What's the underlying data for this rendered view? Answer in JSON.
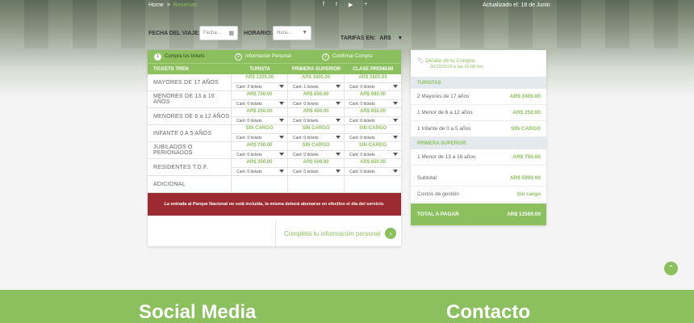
{
  "topbar": {
    "breadcrumb": {
      "home": "Home",
      "separator": ">",
      "current": "Reservas"
    },
    "social_icons": [
      "facebook-icon",
      "twitter-icon",
      "youtube-icon",
      "plus-icon"
    ],
    "updated": "Actualizado el: 18 de Junio"
  },
  "filters": {
    "date_label": "FECHA DEL VIAJE:",
    "date_placeholder": "Fecha...",
    "time_label": "HORARIO:",
    "time_placeholder": "Hora...",
    "currency_label": "TARIFAS EN:",
    "currency_value": "AR$"
  },
  "steps": [
    {
      "num": "1",
      "label": "Comprá tus tickets"
    },
    {
      "num": "2",
      "label": "Información Personal"
    },
    {
      "num": "3",
      "label": "Confirmar Compra"
    }
  ],
  "table": {
    "headers": [
      "TICKETS TREN",
      "TURISTA",
      "PRIMERA SUPERIOR",
      "CLASE PREMIUM"
    ],
    "rows": [
      {
        "label": "MAYORES DE 17 AÑOS",
        "cells": [
          {
            "price": "AR$ 1200.00",
            "qty": "Cant: 2 tickets"
          },
          {
            "price": "AR$ 1600.00",
            "qty": "Cant: 1 tickets"
          },
          {
            "price": "AR$ 2800.00",
            "qty": "Cant: 0 tickets"
          }
        ]
      },
      {
        "label": "MENORES DE 13 a 16 AÑOS",
        "cells": [
          {
            "price": "AR$ 750.00",
            "qty": "Cant: 0 tickets"
          },
          {
            "price": "AR$ 850.00",
            "qty": "Cant: 0 tickets"
          },
          {
            "price": "AR$ 980.00",
            "qty": "Cant: 0 tickets"
          }
        ]
      },
      {
        "label": "MENORES DE 6 a 12 AÑOS",
        "cells": [
          {
            "price": "AR$ 250.00",
            "qty": "Cant: 0 tickets"
          },
          {
            "price": "AR$ 450.00",
            "qty": "Cant: 0 tickets"
          },
          {
            "price": "AR$ 650.00",
            "qty": "Cant: 0 tickets"
          }
        ]
      },
      {
        "label": "INFANTE 0 A 5 AÑOS",
        "cells": [
          {
            "price": "SIN CARGO",
            "qty": "Cant: 0 tickets"
          },
          {
            "price": "SIN CARGO",
            "qty": "Cant: 0 tickets"
          },
          {
            "price": "SIN CARGO",
            "qty": "Cant: 0 tickets"
          }
        ]
      },
      {
        "label": "JUBILADOS O PERIONADOS",
        "cells": [
          {
            "price": "AR$ 750.00",
            "qty": "Cant: 0 tickets"
          },
          {
            "price": "SIN CARGO",
            "qty": "Cant: 0 tickets"
          },
          {
            "price": "SIN CARGO",
            "qty": "Cant: 0 tickets"
          }
        ]
      },
      {
        "label": "RESIDENTES T.D.F.",
        "cells": [
          {
            "price": "AR$ 350.00",
            "qty": "Cant: 0 tickets"
          },
          {
            "price": "AR$ 500.00",
            "qty": "Cant: 0 tickets"
          },
          {
            "price": "AR$ 650.00",
            "qty": "Cant: 0 tickets"
          }
        ]
      },
      {
        "label": "ADICIONAL",
        "cells": [
          {},
          {},
          {}
        ]
      }
    ]
  },
  "notice": "La entrada al Parque Nacional no está incluida, la misma deberá abonarse en efectivo el día del servicio.",
  "next_label": "Completá tu información personal",
  "summary": {
    "title": "Detalle de tu Compra",
    "date": "26/10/2018 a las 16:00 hrs.",
    "sections": [
      {
        "name": "TURISTAS",
        "lines": [
          {
            "label": "2 Mayores de 17 años",
            "value": "AR$ 2400.00"
          },
          {
            "label": "1 Menor de 6 a 12 años",
            "value": "AR$ 250.00"
          },
          {
            "label": "1 Infante de 0 a 5 años",
            "value": "SIN CARGO"
          }
        ]
      },
      {
        "name": "PRIMERA SUPERIOR",
        "lines": [
          {
            "label": "1 Menor de 13 a 16 años",
            "value": "AR$ 750.00"
          }
        ]
      }
    ],
    "subtotal_label": "Subtotal",
    "subtotal_value": "AR$ 5900.00",
    "fees_label": "Costos de gestión",
    "fees_value": "Sin cargo",
    "total_label": "TOTAL A PAGAR",
    "total_value": "AR$ 12560.00"
  },
  "footer": {
    "social_heading": "Social Media",
    "contact_heading": "Contacto"
  },
  "colors": {
    "accent": "#8cc05e",
    "notice": "#9b2b31",
    "section_bg": "#e4e9ee"
  }
}
